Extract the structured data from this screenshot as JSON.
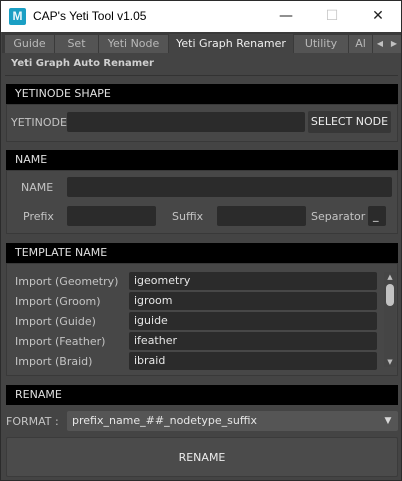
{
  "window": {
    "title": "CAP's Yeti Tool v1.05",
    "app_icon_letter": "M",
    "minimize_glyph": "—",
    "maximize_glyph": "☐",
    "close_glyph": "✕"
  },
  "tabs": [
    {
      "label": "Guide",
      "active": false
    },
    {
      "label": "Set",
      "active": false
    },
    {
      "label": "Yeti Node",
      "active": false
    },
    {
      "label": "Yeti Graph Renamer",
      "active": true
    },
    {
      "label": "Utility",
      "active": false
    },
    {
      "label": "Al",
      "active": false
    }
  ],
  "tab_scroll": {
    "left_arrow": "◀",
    "right_arrow": "▶"
  },
  "panel_title": "Yeti Graph Auto Renamer",
  "yetinode_shape": {
    "header": "YETINODE SHAPE",
    "field_label": "YETINODE",
    "field_value": "",
    "button_label": "SELECT NODE"
  },
  "name_section": {
    "header": "NAME",
    "name_label": "NAME",
    "name_value": "",
    "prefix_label": "Prefix",
    "prefix_value": "",
    "suffix_label": "Suffix",
    "suffix_value": "",
    "separator_label": "Separator",
    "separator_value": "_"
  },
  "template_section": {
    "header": "TEMPLATE NAME",
    "rows": [
      {
        "label": "Import (Geometry)",
        "value": "igeometry"
      },
      {
        "label": "Import (Groom)",
        "value": "igroom"
      },
      {
        "label": "Import (Guide)",
        "value": "iguide"
      },
      {
        "label": "Import (Feather)",
        "value": "ifeather"
      },
      {
        "label": "Import (Braid)",
        "value": "ibraid"
      }
    ],
    "scroll_up_glyph": "▲",
    "scroll_down_glyph": "▼"
  },
  "rename_section": {
    "header": "RENAME",
    "format_label": "FORMAT :",
    "format_value": "prefix_name_##_nodetype_suffix",
    "dropdown_glyph": "▼",
    "button_label": "RENAME"
  },
  "colors": {
    "window_bg": "#444444",
    "section_header_bg": "#000000",
    "field_bg": "#2b2b2b",
    "button_bg": "#5d5d5d",
    "app_icon": "#1a9fc4"
  }
}
